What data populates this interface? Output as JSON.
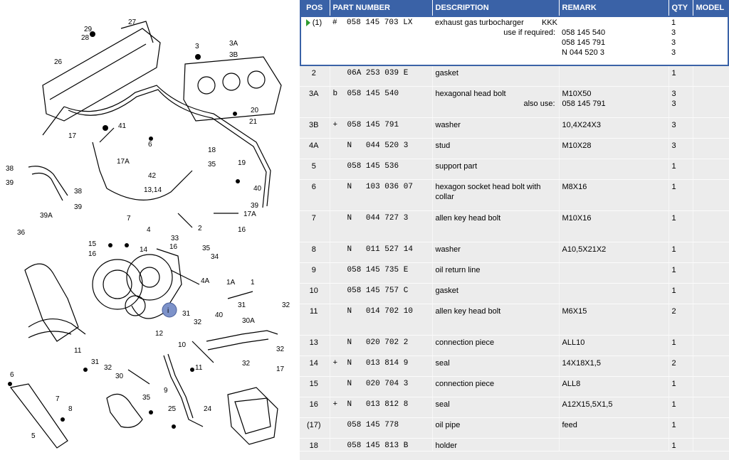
{
  "headers": {
    "pos": "POS",
    "part": "PART NUMBER",
    "desc": "DESCRIPTION",
    "remark": "REMARK",
    "qty": "QTY",
    "model": "MODEL"
  },
  "rows": [
    {
      "pos": "(1)",
      "flag": "#",
      "pn": "058 145 703 LX",
      "desc": "exhaust gas turbocharger",
      "desc_extra": "use if required:",
      "desc_right": "KKK",
      "remark": [
        "",
        "058 145 540",
        "058 145 791",
        "N  044 520 3"
      ],
      "qty": [
        "1",
        "3",
        "3",
        "3"
      ]
    },
    {
      "pos": "2",
      "flag": "",
      "pn": "06A 253 039 E",
      "desc": "gasket",
      "remark": [
        ""
      ],
      "qty": [
        "1"
      ]
    },
    {
      "pos": "3A",
      "flag": "b",
      "pn": "058 145 540",
      "desc": "hexagonal head bolt",
      "desc_extra": "also use:",
      "remark": [
        "M10X50",
        "058 145 791"
      ],
      "qty": [
        "3",
        "3"
      ]
    },
    {
      "pos": "3B",
      "flag": "+",
      "pn": "058 145 791",
      "desc": "washer",
      "remark": [
        "10,4X24X3"
      ],
      "qty": [
        "3"
      ]
    },
    {
      "pos": "4A",
      "flag": "",
      "pn": "N   044 520 3",
      "desc": "stud",
      "remark": [
        "M10X28"
      ],
      "qty": [
        "3"
      ]
    },
    {
      "pos": "5",
      "flag": "",
      "pn": "058 145 536",
      "desc": "support part",
      "remark": [
        ""
      ],
      "qty": [
        "1"
      ]
    },
    {
      "pos": "6",
      "flag": "",
      "pn": "N   103 036 07",
      "desc": "hexagon socket head bolt with collar",
      "remark": [
        "M8X16"
      ],
      "qty": [
        "1"
      ]
    },
    {
      "pos": "7",
      "flag": "",
      "pn": "N   044 727 3",
      "desc": "allen key head bolt",
      "remark": [
        "M10X16"
      ],
      "qty": [
        "1"
      ]
    },
    {
      "pos": "8",
      "flag": "",
      "pn": "N   011 527 14",
      "desc": "washer",
      "remark": [
        "A10,5X21X2"
      ],
      "qty": [
        "1"
      ]
    },
    {
      "pos": "9",
      "flag": "",
      "pn": "058 145 735 E",
      "desc": "oil return line",
      "remark": [
        ""
      ],
      "qty": [
        "1"
      ]
    },
    {
      "pos": "10",
      "flag": "",
      "pn": "058 145 757 C",
      "desc": "gasket",
      "remark": [
        ""
      ],
      "qty": [
        "1"
      ]
    },
    {
      "pos": "11",
      "flag": "",
      "pn": "N   014 702 10",
      "desc": "allen key head bolt",
      "remark": [
        "M6X15"
      ],
      "qty": [
        "2"
      ]
    },
    {
      "pos": "13",
      "flag": "",
      "pn": "N   020 702 2",
      "desc": "connection piece",
      "remark": [
        "ALL10"
      ],
      "qty": [
        "1"
      ]
    },
    {
      "pos": "14",
      "flag": "+",
      "pn": "N   013 814 9",
      "desc": "seal",
      "remark": [
        "14X18X1,5"
      ],
      "qty": [
        "2"
      ]
    },
    {
      "pos": "15",
      "flag": "",
      "pn": "N   020 704 3",
      "desc": "connection piece",
      "remark": [
        "ALL8"
      ],
      "qty": [
        "1"
      ]
    },
    {
      "pos": "16",
      "flag": "+",
      "pn": "N   013 812 8",
      "desc": "seal",
      "remark": [
        "A12X15,5X1,5"
      ],
      "qty": [
        "1"
      ]
    },
    {
      "pos": "(17)",
      "flag": "",
      "pn": "058 145 778",
      "desc": "oil pipe",
      "remark": [
        "feed"
      ],
      "qty": [
        "1"
      ]
    },
    {
      "pos": "18",
      "flag": "",
      "pn": "058 145 813 B",
      "desc": "holder",
      "remark": [
        ""
      ],
      "qty": [
        "1"
      ]
    }
  ],
  "diagram": {
    "marker": "i",
    "labels": [
      "29",
      "28",
      "27",
      "26",
      "3",
      "3A",
      "3B",
      "20",
      "21",
      "17",
      "41",
      "6",
      "18",
      "19",
      "17A",
      "35",
      "38",
      "39",
      "42",
      "13,14",
      "40",
      "39",
      "38",
      "39",
      "39A",
      "36",
      "17A",
      "16",
      "2",
      "4",
      "33",
      "16",
      "7",
      "15",
      "16",
      "14",
      "35",
      "34",
      "4A",
      "1A",
      "1",
      "31",
      "32",
      "10",
      "31",
      "40",
      "11",
      "30A",
      "32",
      "12",
      "11",
      "31",
      "32",
      "30",
      "32",
      "17",
      "6",
      "7",
      "8",
      "5",
      "35",
      "25",
      "24",
      "9",
      "32"
    ]
  }
}
